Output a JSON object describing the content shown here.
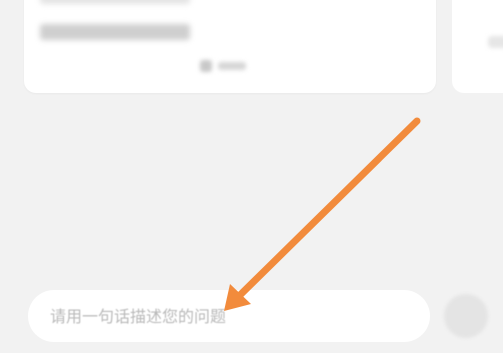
{
  "input": {
    "placeholder": "请用一句话描述您的问题",
    "value": ""
  },
  "icons": {
    "send": "send-icon",
    "card_action": "comment-icon"
  },
  "colors": {
    "background": "#f2f2f2",
    "card": "#ffffff",
    "arrow": "#f28b3c",
    "placeholder": "#b9b9b9"
  }
}
